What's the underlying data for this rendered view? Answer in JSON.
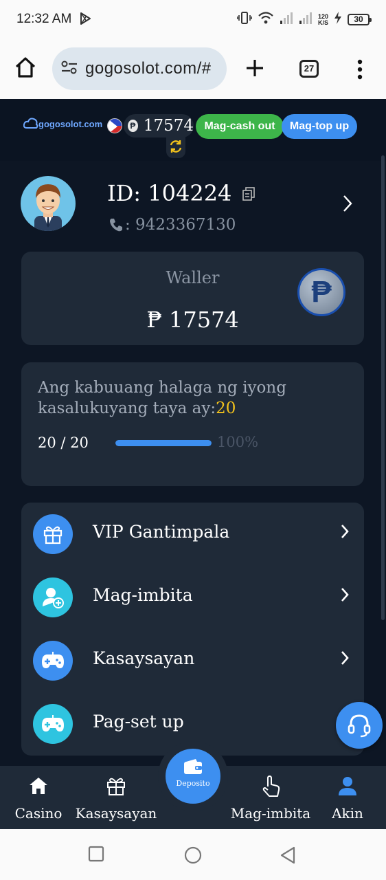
{
  "status_bar": {
    "time": "12:32 AM",
    "net_speed_value": "120",
    "net_speed_unit": "K/S",
    "battery": "30"
  },
  "browser": {
    "url": "gogosolot.com/#",
    "tab_count": "27"
  },
  "header": {
    "logo_text": "gogosolot.com",
    "balance": "17574",
    "coin_symbol": "₱",
    "cash_out_label": "Mag-cash out",
    "top_up_label": "Mag-top up"
  },
  "profile": {
    "id_text": "ID: 104224",
    "phone": ": 9423367130"
  },
  "wallet": {
    "label": "Waller",
    "value": "₱ 17574",
    "coin_symbol": "₱"
  },
  "bet": {
    "desc": "Ang kabuuang halaga ng iyong kasalukuyang taya ay:",
    "desc_value": "20",
    "count": "20 / 20",
    "percent_text": "100%",
    "progress": 1.0
  },
  "menu": [
    {
      "label": "VIP Gantimpala",
      "icon": "gift-icon",
      "color": "#3d8ff0"
    },
    {
      "label": "Mag-imbita",
      "icon": "add-user-icon",
      "color": "#2ec4e0"
    },
    {
      "label": "Kasaysayan",
      "icon": "gamepad-icon",
      "color": "#3d8ff0"
    },
    {
      "label": "Pag-set up",
      "icon": "gamepad-icon",
      "color": "#2ec4e0"
    }
  ],
  "bottom_nav": {
    "casino": "Casino",
    "history": "Kasaysayan",
    "deposit": "Deposito",
    "invite": "Mag-imbita",
    "me": "Akin"
  },
  "colors": {
    "accent": "#3d8ff0",
    "cashout": "#3db54a",
    "highlight": "#f2c21c",
    "background": "#0d1624",
    "card": "#1f2a38"
  }
}
